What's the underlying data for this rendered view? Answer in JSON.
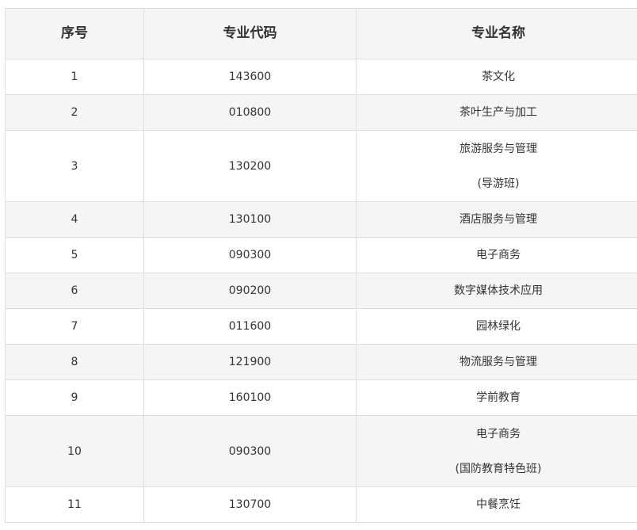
{
  "table": {
    "headers": [
      "序号",
      "专业代码",
      "专业名称"
    ],
    "rows": [
      {
        "no": "1",
        "code": "143600",
        "name": [
          "茶文化"
        ]
      },
      {
        "no": "2",
        "code": "010800",
        "name": [
          "茶叶生产与加工"
        ]
      },
      {
        "no": "3",
        "code": "130200",
        "name": [
          "旅游服务与管理",
          "(导游班)"
        ]
      },
      {
        "no": "4",
        "code": "130100",
        "name": [
          "酒店服务与管理"
        ]
      },
      {
        "no": "5",
        "code": "090300",
        "name": [
          "电子商务"
        ]
      },
      {
        "no": "6",
        "code": "090200",
        "name": [
          "数字媒体技术应用"
        ]
      },
      {
        "no": "7",
        "code": "011600",
        "name": [
          "园林绿化"
        ]
      },
      {
        "no": "8",
        "code": "121900",
        "name": [
          "物流服务与管理"
        ]
      },
      {
        "no": "9",
        "code": "160100",
        "name": [
          "学前教育"
        ]
      },
      {
        "no": "10",
        "code": "090300",
        "name": [
          "电子商务",
          "(国防教育特色班)"
        ]
      },
      {
        "no": "11",
        "code": "130700",
        "name": [
          "中餐烹饪"
        ]
      }
    ]
  },
  "colors": {
    "header_bg": "#f5f5f5",
    "stripe_bg": "#f5f5f5",
    "border": "#dddddd",
    "text": "#333333"
  }
}
